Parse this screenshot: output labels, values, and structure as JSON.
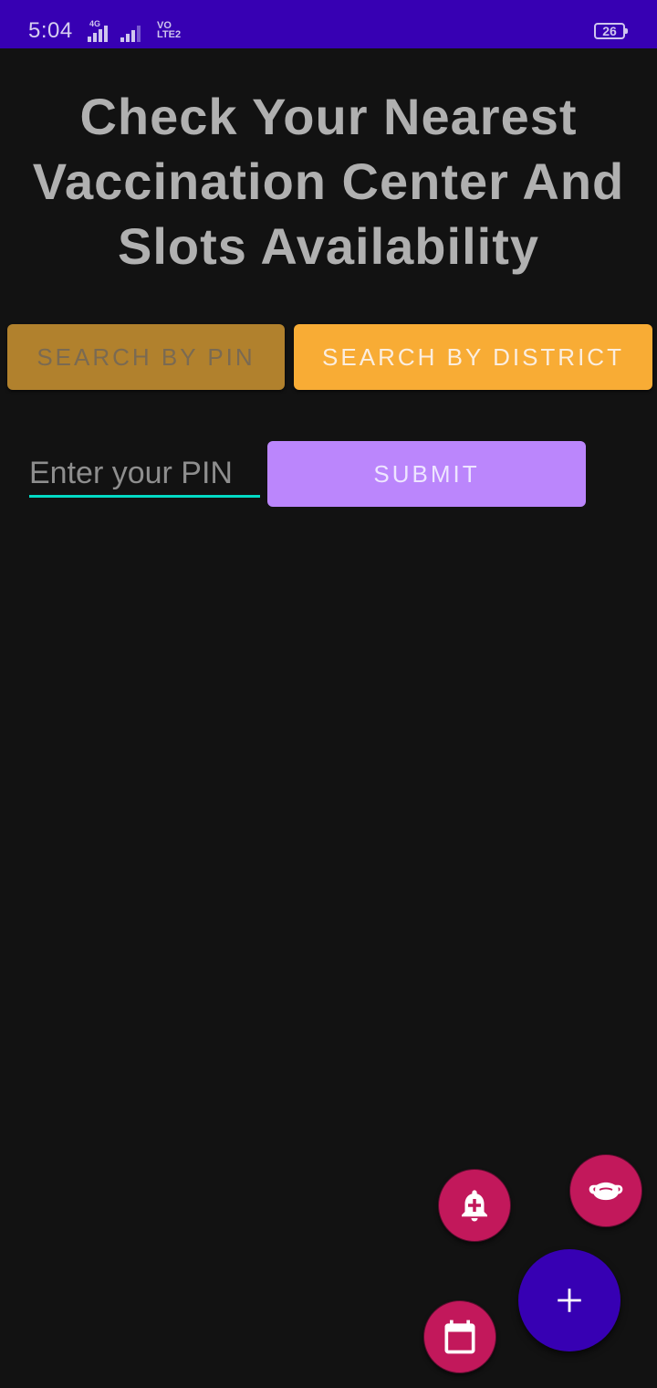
{
  "status_bar": {
    "time": "5:04",
    "network_label": "4G",
    "volte_label_top": "VO",
    "volte_label_bottom": "LTE2",
    "battery_level": "26",
    "background_color": "#3700b3"
  },
  "header": {
    "title": "Check Your Nearest Vaccination Center And Slots Availability"
  },
  "tabs": [
    {
      "label": "SEARCH BY PIN",
      "selected": true,
      "color": "#b1812d"
    },
    {
      "label": "SEARCH BY DISTRICT",
      "selected": false,
      "color": "#f8ac35"
    }
  ],
  "pin_form": {
    "input_value": "",
    "placeholder": "Enter your PIN",
    "submit_label": "SUBMIT",
    "accent_color": "#03dac5",
    "submit_color": "#bb86fc"
  },
  "fabs": {
    "notification": {
      "icon": "notification-add-icon",
      "color": "#c2185b"
    },
    "mask": {
      "icon": "mask-icon",
      "color": "#c2185b"
    },
    "calendar": {
      "icon": "calendar-icon",
      "color": "#c2185b"
    },
    "main": {
      "icon": "plus-icon",
      "color": "#3700b3"
    }
  }
}
